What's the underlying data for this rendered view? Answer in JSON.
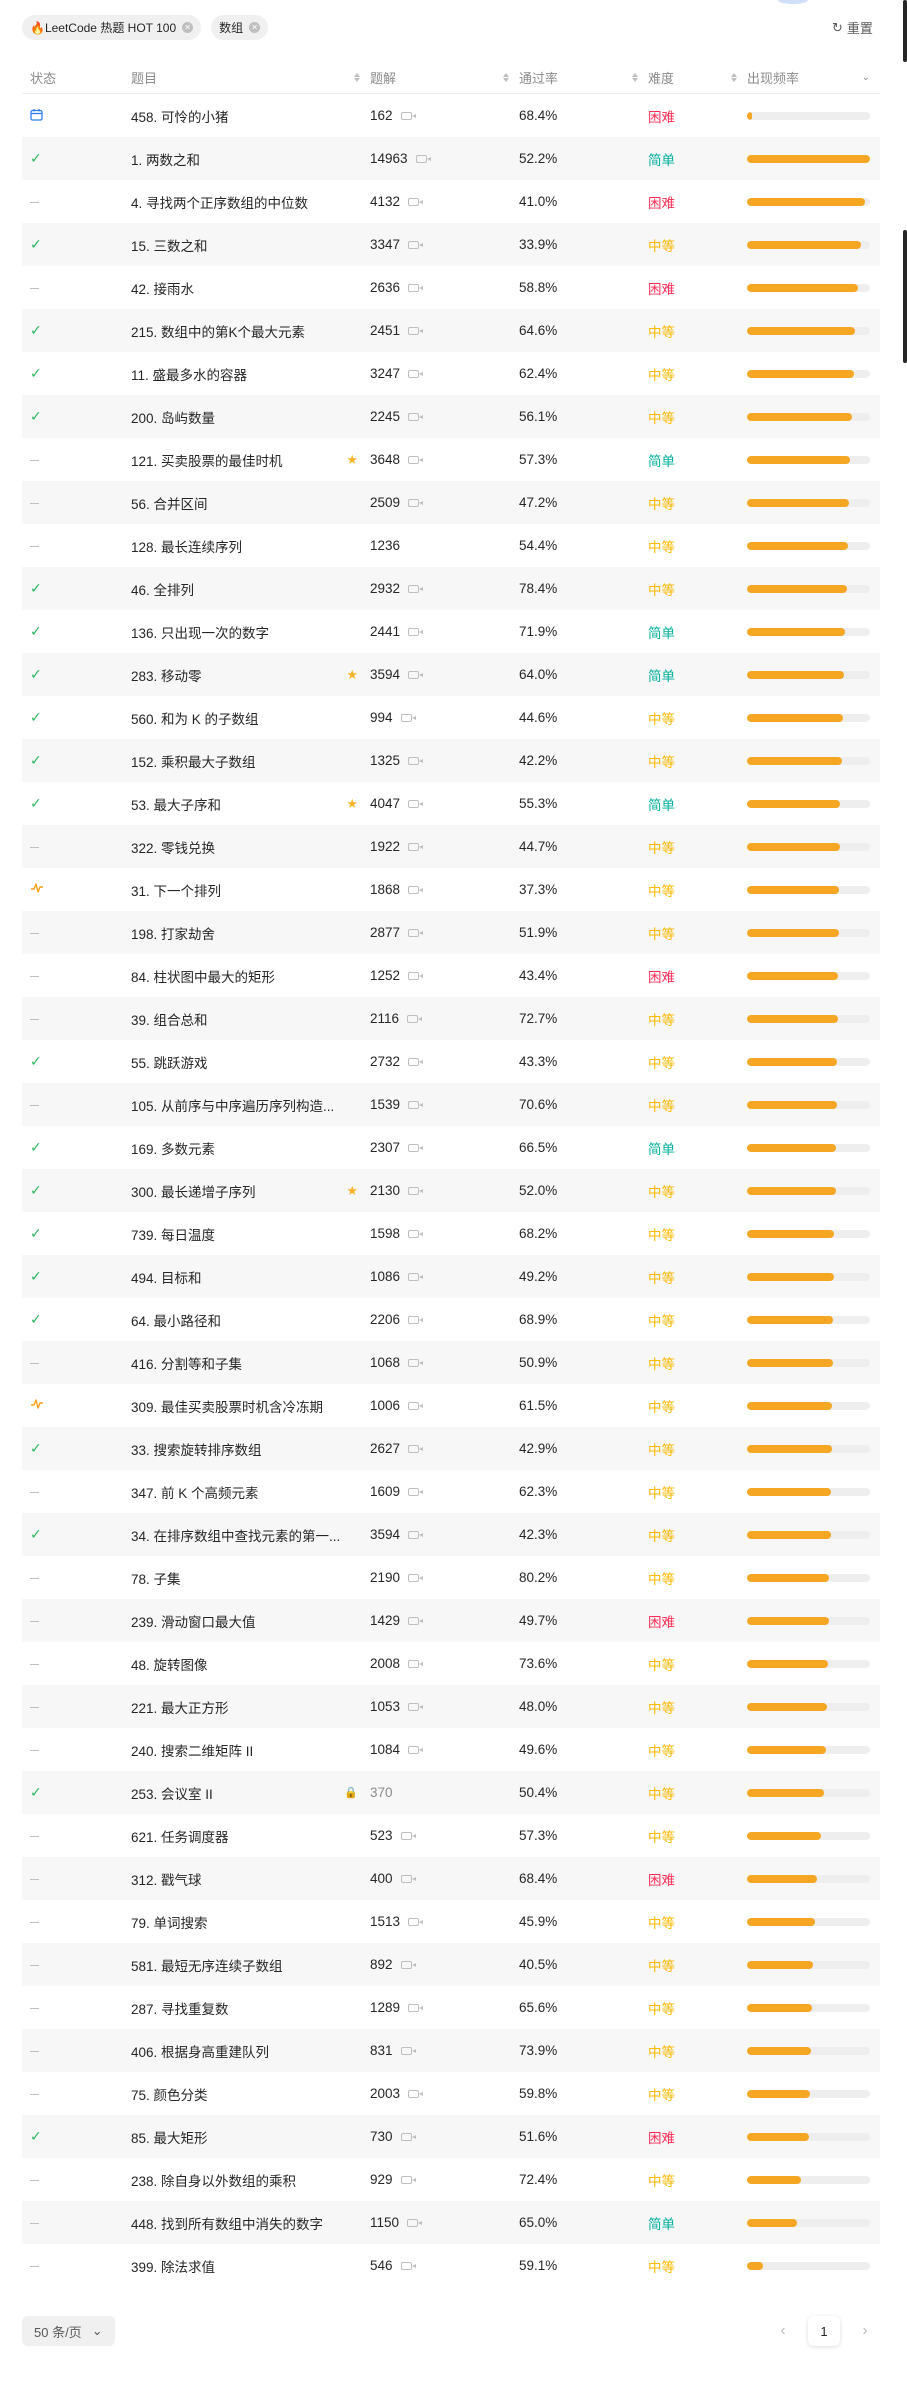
{
  "filters": [
    {
      "label": "🔥LeetCode 热题 HOT 100"
    },
    {
      "label": "数组"
    }
  ],
  "reset_label": "重置",
  "columns": {
    "status": "状态",
    "title": "题目",
    "solutions": "题解",
    "acceptance": "通过率",
    "difficulty": "难度",
    "frequency": "出现频率"
  },
  "rows": [
    {
      "status": "calendar",
      "title": "458. 可怜的小猪",
      "solutions": "162",
      "video": true,
      "rate": "68.4%",
      "difficulty": "困难",
      "level": "hard",
      "freq": 0.04
    },
    {
      "status": "solved",
      "title": "1. 两数之和",
      "solutions": "14963",
      "video": true,
      "rate": "52.2%",
      "difficulty": "简单",
      "level": "easy",
      "freq": 1.0
    },
    {
      "status": "none",
      "title": "4. 寻找两个正序数组的中位数",
      "solutions": "4132",
      "video": true,
      "rate": "41.0%",
      "difficulty": "困难",
      "level": "hard",
      "freq": 0.96
    },
    {
      "status": "solved",
      "title": "15. 三数之和",
      "solutions": "3347",
      "video": true,
      "rate": "33.9%",
      "difficulty": "中等",
      "level": "medium",
      "freq": 0.93
    },
    {
      "status": "none",
      "title": "42. 接雨水",
      "solutions": "2636",
      "video": true,
      "rate": "58.8%",
      "difficulty": "困难",
      "level": "hard",
      "freq": 0.9
    },
    {
      "status": "solved",
      "title": "215. 数组中的第K个最大元素",
      "solutions": "2451",
      "video": true,
      "rate": "64.6%",
      "difficulty": "中等",
      "level": "medium",
      "freq": 0.88
    },
    {
      "status": "solved",
      "title": "11. 盛最多水的容器",
      "solutions": "3247",
      "video": true,
      "rate": "62.4%",
      "difficulty": "中等",
      "level": "medium",
      "freq": 0.87
    },
    {
      "status": "solved",
      "title": "200. 岛屿数量",
      "solutions": "2245",
      "video": true,
      "rate": "56.1%",
      "difficulty": "中等",
      "level": "medium",
      "freq": 0.85
    },
    {
      "status": "none",
      "title": "121. 买卖股票的最佳时机",
      "star": true,
      "solutions": "3648",
      "video": true,
      "rate": "57.3%",
      "difficulty": "简单",
      "level": "easy",
      "freq": 0.84
    },
    {
      "status": "none",
      "title": "56. 合并区间",
      "solutions": "2509",
      "video": true,
      "rate": "47.2%",
      "difficulty": "中等",
      "level": "medium",
      "freq": 0.83
    },
    {
      "status": "none",
      "title": "128. 最长连续序列",
      "solutions": "1236",
      "video": false,
      "rate": "54.4%",
      "difficulty": "中等",
      "level": "medium",
      "freq": 0.82
    },
    {
      "status": "solved",
      "title": "46. 全排列",
      "solutions": "2932",
      "video": true,
      "rate": "78.4%",
      "difficulty": "中等",
      "level": "medium",
      "freq": 0.81
    },
    {
      "status": "solved",
      "title": "136. 只出现一次的数字",
      "solutions": "2441",
      "video": true,
      "rate": "71.9%",
      "difficulty": "简单",
      "level": "easy",
      "freq": 0.8
    },
    {
      "status": "solved",
      "title": "283. 移动零",
      "star": true,
      "solutions": "3594",
      "video": true,
      "rate": "64.0%",
      "difficulty": "简单",
      "level": "easy",
      "freq": 0.79
    },
    {
      "status": "solved",
      "title": "560. 和为 K 的子数组",
      "solutions": "994",
      "video": true,
      "rate": "44.6%",
      "difficulty": "中等",
      "level": "medium",
      "freq": 0.78
    },
    {
      "status": "solved",
      "title": "152. 乘积最大子数组",
      "solutions": "1325",
      "video": true,
      "rate": "42.2%",
      "difficulty": "中等",
      "level": "medium",
      "freq": 0.77
    },
    {
      "status": "solved",
      "title": "53. 最大子序和",
      "star": true,
      "solutions": "4047",
      "video": true,
      "rate": "55.3%",
      "difficulty": "简单",
      "level": "easy",
      "freq": 0.76
    },
    {
      "status": "none",
      "title": "322. 零钱兑换",
      "solutions": "1922",
      "video": true,
      "rate": "44.7%",
      "difficulty": "中等",
      "level": "medium",
      "freq": 0.76
    },
    {
      "status": "attempted",
      "title": "31. 下一个排列",
      "solutions": "1868",
      "video": true,
      "rate": "37.3%",
      "difficulty": "中等",
      "level": "medium",
      "freq": 0.75
    },
    {
      "status": "none",
      "title": "198. 打家劫舍",
      "solutions": "2877",
      "video": true,
      "rate": "51.9%",
      "difficulty": "中等",
      "level": "medium",
      "freq": 0.75
    },
    {
      "status": "none",
      "title": "84. 柱状图中最大的矩形",
      "solutions": "1252",
      "video": true,
      "rate": "43.4%",
      "difficulty": "困难",
      "level": "hard",
      "freq": 0.74
    },
    {
      "status": "none",
      "title": "39. 组合总和",
      "solutions": "2116",
      "video": true,
      "rate": "72.7%",
      "difficulty": "中等",
      "level": "medium",
      "freq": 0.74
    },
    {
      "status": "solved",
      "title": "55. 跳跃游戏",
      "solutions": "2732",
      "video": true,
      "rate": "43.3%",
      "difficulty": "中等",
      "level": "medium",
      "freq": 0.73
    },
    {
      "status": "none",
      "title": "105. 从前序与中序遍历序列构造...",
      "solutions": "1539",
      "video": true,
      "rate": "70.6%",
      "difficulty": "中等",
      "level": "medium",
      "freq": 0.73
    },
    {
      "status": "solved",
      "title": "169. 多数元素",
      "solutions": "2307",
      "video": true,
      "rate": "66.5%",
      "difficulty": "简单",
      "level": "easy",
      "freq": 0.72
    },
    {
      "status": "solved",
      "title": "300. 最长递增子序列",
      "star": true,
      "solutions": "2130",
      "video": true,
      "rate": "52.0%",
      "difficulty": "中等",
      "level": "medium",
      "freq": 0.72
    },
    {
      "status": "solved",
      "title": "739. 每日温度",
      "solutions": "1598",
      "video": true,
      "rate": "68.2%",
      "difficulty": "中等",
      "level": "medium",
      "freq": 0.71
    },
    {
      "status": "solved",
      "title": "494. 目标和",
      "solutions": "1086",
      "video": true,
      "rate": "49.2%",
      "difficulty": "中等",
      "level": "medium",
      "freq": 0.71
    },
    {
      "status": "solved",
      "title": "64. 最小路径和",
      "solutions": "2206",
      "video": true,
      "rate": "68.9%",
      "difficulty": "中等",
      "level": "medium",
      "freq": 0.7
    },
    {
      "status": "none",
      "title": "416. 分割等和子集",
      "solutions": "1068",
      "video": true,
      "rate": "50.9%",
      "difficulty": "中等",
      "level": "medium",
      "freq": 0.7
    },
    {
      "status": "attempted",
      "title": "309. 最佳买卖股票时机含冷冻期",
      "solutions": "1006",
      "video": true,
      "rate": "61.5%",
      "difficulty": "中等",
      "level": "medium",
      "freq": 0.69
    },
    {
      "status": "solved",
      "title": "33. 搜索旋转排序数组",
      "solutions": "2627",
      "video": true,
      "rate": "42.9%",
      "difficulty": "中等",
      "level": "medium",
      "freq": 0.69
    },
    {
      "status": "none",
      "title": "347. 前 K 个高频元素",
      "solutions": "1609",
      "video": true,
      "rate": "62.3%",
      "difficulty": "中等",
      "level": "medium",
      "freq": 0.68
    },
    {
      "status": "solved",
      "title": "34. 在排序数组中查找元素的第一...",
      "solutions": "3594",
      "video": true,
      "rate": "42.3%",
      "difficulty": "中等",
      "level": "medium",
      "freq": 0.68
    },
    {
      "status": "none",
      "title": "78. 子集",
      "solutions": "2190",
      "video": true,
      "rate": "80.2%",
      "difficulty": "中等",
      "level": "medium",
      "freq": 0.67
    },
    {
      "status": "none",
      "title": "239. 滑动窗口最大值",
      "solutions": "1429",
      "video": true,
      "rate": "49.7%",
      "difficulty": "困难",
      "level": "hard",
      "freq": 0.67
    },
    {
      "status": "none",
      "title": "48. 旋转图像",
      "solutions": "2008",
      "video": true,
      "rate": "73.6%",
      "difficulty": "中等",
      "level": "medium",
      "freq": 0.66
    },
    {
      "status": "none",
      "title": "221. 最大正方形",
      "solutions": "1053",
      "video": true,
      "rate": "48.0%",
      "difficulty": "中等",
      "level": "medium",
      "freq": 0.65
    },
    {
      "status": "none",
      "title": "240. 搜索二维矩阵 II",
      "solutions": "1084",
      "video": true,
      "rate": "49.6%",
      "difficulty": "中等",
      "level": "medium",
      "freq": 0.64
    },
    {
      "status": "solved",
      "title": "253. 会议室 II",
      "locked": true,
      "solutions": "370",
      "video": false,
      "muted": true,
      "rate": "50.4%",
      "difficulty": "中等",
      "level": "medium",
      "freq": 0.63
    },
    {
      "status": "none",
      "title": "621. 任务调度器",
      "solutions": "523",
      "video": true,
      "rate": "57.3%",
      "difficulty": "中等",
      "level": "medium",
      "freq": 0.6
    },
    {
      "status": "none",
      "title": "312. 戳气球",
      "solutions": "400",
      "video": true,
      "rate": "68.4%",
      "difficulty": "困难",
      "level": "hard",
      "freq": 0.57
    },
    {
      "status": "none",
      "title": "79. 单词搜索",
      "solutions": "1513",
      "video": true,
      "rate": "45.9%",
      "difficulty": "中等",
      "level": "medium",
      "freq": 0.55
    },
    {
      "status": "none",
      "title": "581. 最短无序连续子数组",
      "solutions": "892",
      "video": true,
      "rate": "40.5%",
      "difficulty": "中等",
      "level": "medium",
      "freq": 0.54
    },
    {
      "status": "none",
      "title": "287. 寻找重复数",
      "solutions": "1289",
      "video": true,
      "rate": "65.6%",
      "difficulty": "中等",
      "level": "medium",
      "freq": 0.53
    },
    {
      "status": "none",
      "title": "406. 根据身高重建队列",
      "solutions": "831",
      "video": true,
      "rate": "73.9%",
      "difficulty": "中等",
      "level": "medium",
      "freq": 0.52
    },
    {
      "status": "none",
      "title": "75. 颜色分类",
      "solutions": "2003",
      "video": true,
      "rate": "59.8%",
      "difficulty": "中等",
      "level": "medium",
      "freq": 0.51
    },
    {
      "status": "solved",
      "title": "85. 最大矩形",
      "solutions": "730",
      "video": true,
      "rate": "51.6%",
      "difficulty": "困难",
      "level": "hard",
      "freq": 0.5
    },
    {
      "status": "none",
      "title": "238. 除自身以外数组的乘积",
      "solutions": "929",
      "video": true,
      "rate": "72.4%",
      "difficulty": "中等",
      "level": "medium",
      "freq": 0.44
    },
    {
      "status": "none",
      "title": "448. 找到所有数组中消失的数字",
      "solutions": "1150",
      "video": true,
      "rate": "65.0%",
      "difficulty": "简单",
      "level": "easy",
      "freq": 0.41
    },
    {
      "status": "none",
      "title": "399. 除法求值",
      "solutions": "546",
      "video": true,
      "rate": "59.1%",
      "difficulty": "中等",
      "level": "medium",
      "freq": 0.13
    }
  ],
  "pagination": {
    "page_size": "50 条/页",
    "current_page": "1"
  },
  "colors": {
    "easy": "#00af9b",
    "medium": "#ffb800",
    "hard": "#ff2d55",
    "frequency_bar": "#f5a623",
    "solved": "#2db55d"
  }
}
